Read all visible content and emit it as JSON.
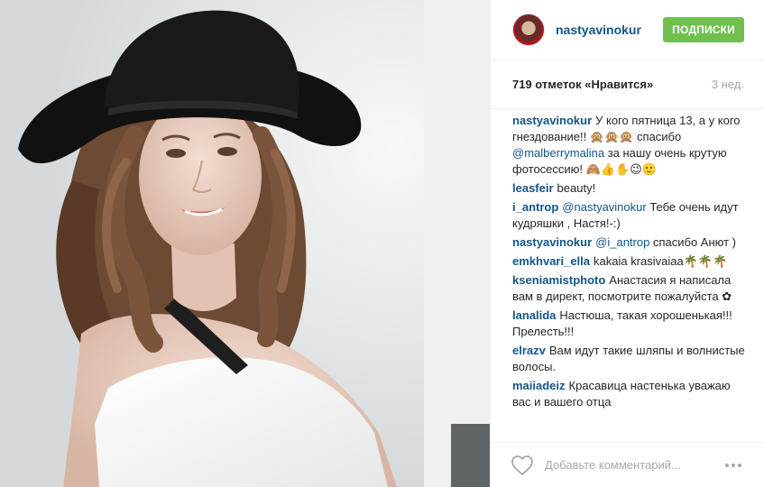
{
  "header": {
    "username": "nastyavinokur",
    "follow_label": "ПОДПИСКИ"
  },
  "stats": {
    "likes": "719 отметок «Нравится»",
    "time": "3 нед."
  },
  "comments": [
    {
      "user": "nastyavinokur",
      "text_a": "У кого пятница 13, а у кого гнездование!! 🙊🙊🙊 спасибо",
      "mention": "@malberrymalina",
      "text_b": "за нашу очень крутую фотосессию! 🙈👍✋😉🙂"
    },
    {
      "user": "leasfeir",
      "text": "beauty!"
    },
    {
      "user": "i_antrop",
      "mention": "@nastyavinokur",
      "text": "Тебе очень идут кудряшки , Настя!-:)"
    },
    {
      "user": "nastyavinokur",
      "mention": "@i_antrop",
      "text": "спасибо Анют )"
    },
    {
      "user": "emkhvari_ella",
      "text": "kakaia krasivaiaa🌴🌴🌴"
    },
    {
      "user": "kseniamistphoto",
      "text": "Анастасия я написала вам в директ, посмотрите пожалуйста ✿"
    },
    {
      "user": "lanalida",
      "text": "Настюша, такая хорошенькая!!! Прелесть!!!"
    },
    {
      "user": "elrazv",
      "text": "Вам идут такие шляпы и волнистые волосы."
    },
    {
      "user": "maiiadeiz",
      "text": "Красавица настенька уважаю вас и вашего отца"
    }
  ],
  "footer": {
    "comment_placeholder": "Добавьте комментарий..."
  },
  "icons": {
    "like": "heart-icon",
    "more": "more-options-icon"
  },
  "colors": {
    "username_blue": "#125688",
    "follow_green": "#70c050",
    "muted_gray": "#a5a7aa"
  }
}
